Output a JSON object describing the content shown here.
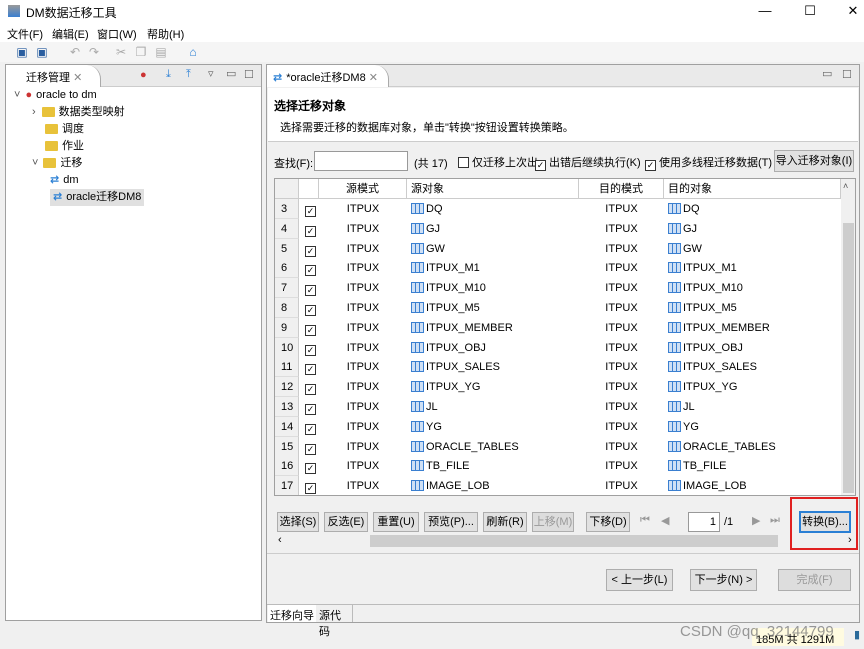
{
  "window": {
    "title": "DM数据迁移工具",
    "minimize": "—",
    "maximize": "☐",
    "close": "✕"
  },
  "menu": [
    "文件(F)",
    "编辑(E)",
    "窗口(W)",
    "帮助(H)"
  ],
  "toolbar": {
    "icons": [
      "save-icon",
      "save-all-icon",
      "undo-icon",
      "redo-icon",
      "cut-icon",
      "copy-icon",
      "paste-icon",
      "home-icon"
    ]
  },
  "left_panel": {
    "tab": "迁移管理",
    "tree": [
      {
        "label": "oracle  to dm",
        "level": 0,
        "icon": "db-icon",
        "expanded": true
      },
      {
        "label": "数据类型映射",
        "level": 1,
        "icon": "folder-icon",
        "expanded": false
      },
      {
        "label": "调度",
        "level": 1,
        "icon": "folder-icon"
      },
      {
        "label": "作业",
        "level": 1,
        "icon": "folder-icon"
      },
      {
        "label": "迁移",
        "level": 1,
        "icon": "folder-icon",
        "expanded": true
      },
      {
        "label": "dm",
        "level": 2,
        "icon": "migrate-icon"
      },
      {
        "label": "oracle迁移DM8",
        "level": 2,
        "icon": "migrate-icon",
        "selected": true
      }
    ]
  },
  "editor": {
    "tab": "*oracle迁移DM8",
    "title": "选择迁移对象",
    "description": "选择需要迁移的数据库对象，单击\"转换\"按钮设置转换策略。",
    "search_label": "查找(F):",
    "search_value": "",
    "count": "(共 17)",
    "options": [
      {
        "label": "仅迁移上次出",
        "checked": false
      },
      {
        "label": "出错后继续执行(K)",
        "checked": true
      },
      {
        "label": "使用多线程迁移数据(T)",
        "checked": true
      }
    ],
    "import_button": "导入迁移对象(I)",
    "columns": [
      "",
      "",
      "源模式",
      "源对象",
      "目的模式",
      "目的对象"
    ],
    "rows": [
      {
        "n": "3",
        "src_schema": "ITPUX",
        "src_obj": "DQ",
        "dst_schema": "ITPUX",
        "dst_obj": "DQ"
      },
      {
        "n": "4",
        "src_schema": "ITPUX",
        "src_obj": "GJ",
        "dst_schema": "ITPUX",
        "dst_obj": "GJ"
      },
      {
        "n": "5",
        "src_schema": "ITPUX",
        "src_obj": "GW",
        "dst_schema": "ITPUX",
        "dst_obj": "GW"
      },
      {
        "n": "6",
        "src_schema": "ITPUX",
        "src_obj": "ITPUX_M1",
        "dst_schema": "ITPUX",
        "dst_obj": "ITPUX_M1"
      },
      {
        "n": "7",
        "src_schema": "ITPUX",
        "src_obj": "ITPUX_M10",
        "dst_schema": "ITPUX",
        "dst_obj": "ITPUX_M10"
      },
      {
        "n": "8",
        "src_schema": "ITPUX",
        "src_obj": "ITPUX_M5",
        "dst_schema": "ITPUX",
        "dst_obj": "ITPUX_M5"
      },
      {
        "n": "9",
        "src_schema": "ITPUX",
        "src_obj": "ITPUX_MEMBER",
        "dst_schema": "ITPUX",
        "dst_obj": "ITPUX_MEMBER"
      },
      {
        "n": "10",
        "src_schema": "ITPUX",
        "src_obj": "ITPUX_OBJ",
        "dst_schema": "ITPUX",
        "dst_obj": "ITPUX_OBJ"
      },
      {
        "n": "11",
        "src_schema": "ITPUX",
        "src_obj": "ITPUX_SALES",
        "dst_schema": "ITPUX",
        "dst_obj": "ITPUX_SALES"
      },
      {
        "n": "12",
        "src_schema": "ITPUX",
        "src_obj": "ITPUX_YG",
        "dst_schema": "ITPUX",
        "dst_obj": "ITPUX_YG"
      },
      {
        "n": "13",
        "src_schema": "ITPUX",
        "src_obj": "JL",
        "dst_schema": "ITPUX",
        "dst_obj": "JL"
      },
      {
        "n": "14",
        "src_schema": "ITPUX",
        "src_obj": "YG",
        "dst_schema": "ITPUX",
        "dst_obj": "YG"
      },
      {
        "n": "15",
        "src_schema": "ITPUX",
        "src_obj": "ORACLE_TABLES",
        "dst_schema": "ITPUX",
        "dst_obj": "ORACLE_TABLES"
      },
      {
        "n": "16",
        "src_schema": "ITPUX",
        "src_obj": "TB_FILE",
        "dst_schema": "ITPUX",
        "dst_obj": "TB_FILE"
      },
      {
        "n": "17",
        "src_schema": "ITPUX",
        "src_obj": "IMAGE_LOB",
        "dst_schema": "ITPUX",
        "dst_obj": "IMAGE_LOB"
      }
    ],
    "buttons": {
      "select": "选择(S)",
      "invert": "反选(E)",
      "reset": "重置(U)",
      "preview": "预览(P)...",
      "refresh": "刷新(R)",
      "move_up": "上移(M)",
      "move_down": "下移(D)",
      "convert": "转换(B)..."
    },
    "pager": {
      "page": "1",
      "total": "/1"
    },
    "nav": {
      "prev": "< 上一步(L)",
      "next": "下一步(N) >",
      "finish": "完成(F)"
    },
    "bottom_tabs": [
      "迁移向导",
      "源代码"
    ]
  },
  "status": {
    "memory": "185M 共 1291M"
  },
  "watermark": "CSDN @qq_32144799",
  "colors": {
    "highlight": "#e02020",
    "accent": "#2a7fd4"
  }
}
